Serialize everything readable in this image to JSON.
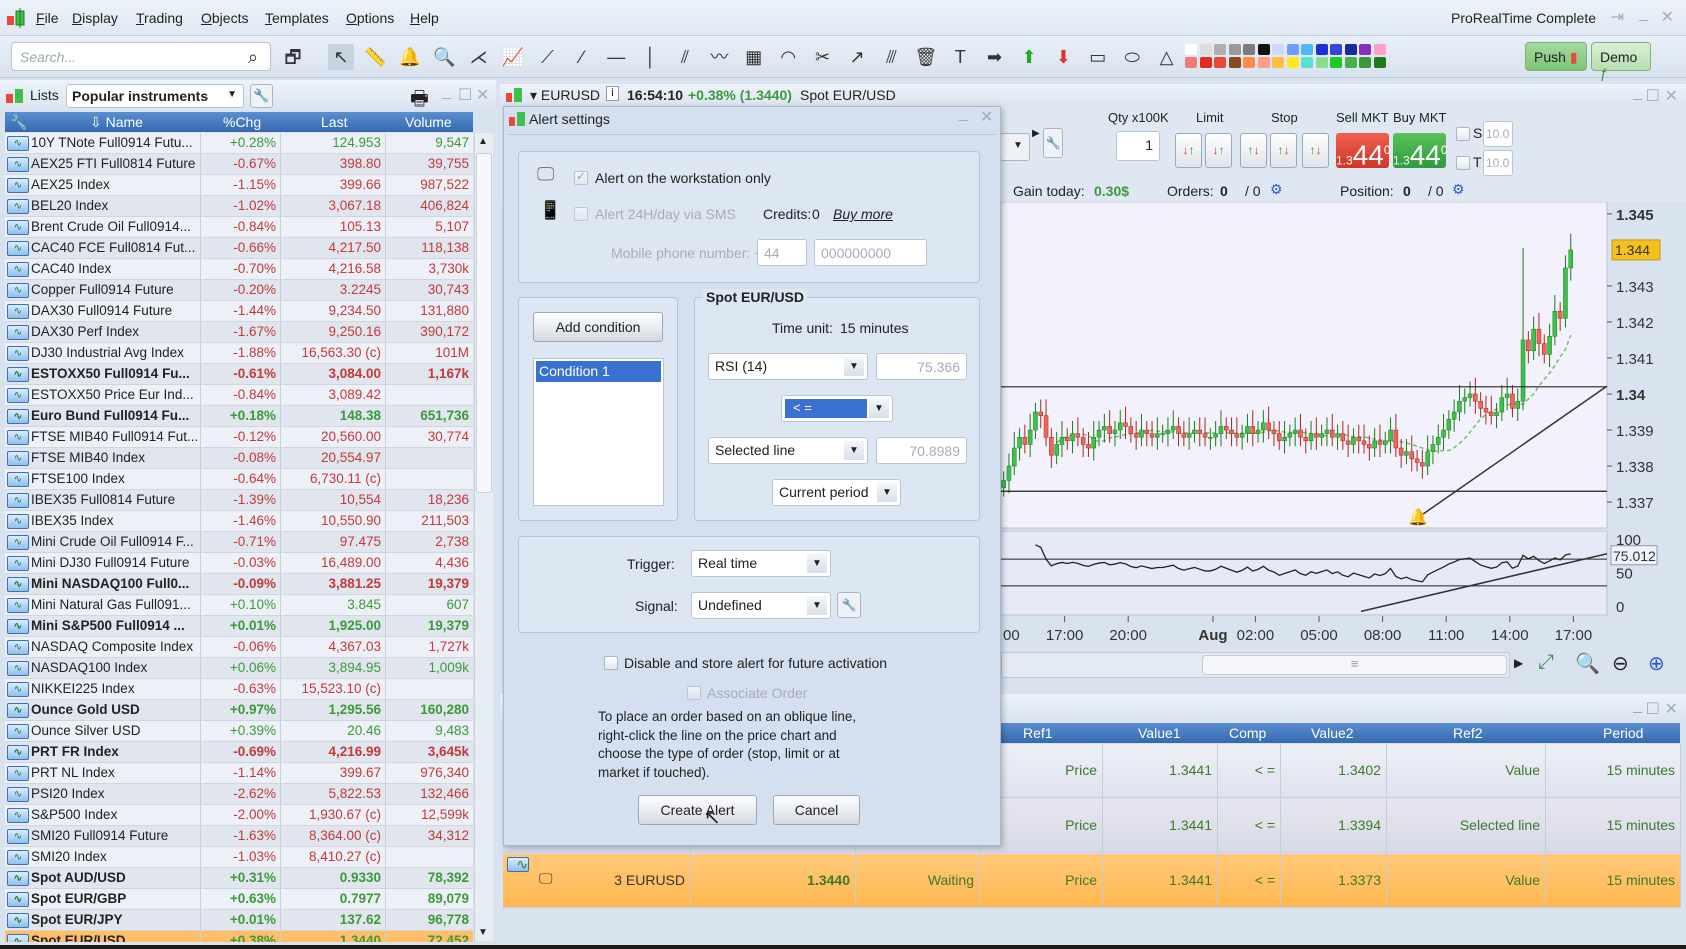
{
  "app": {
    "title": "ProRealTime Complete",
    "push_label": "Push",
    "demo_label": "Demo"
  },
  "menu": [
    "File",
    "Display",
    "Trading",
    "Objects",
    "Templates",
    "Options",
    "Help"
  ],
  "search": {
    "placeholder": "Search..."
  },
  "palette": {
    "top": [
      "#ffffff",
      "#dcdcdc",
      "#b0b0b0",
      "#999999",
      "#7d7d7d",
      "#111111",
      "#cdd7ff",
      "#6f9cff",
      "#4fb9f5",
      "#1c2ed8",
      "#3346d8",
      "#1a2a9a",
      "#8a2ec0",
      "#ff9ec8"
    ],
    "bottom": [
      "#f07a7a",
      "#e8281e",
      "#e84a3a",
      "#8a4a1e",
      "#ff8a4a",
      "#ff9a8a",
      "#ffc040",
      "#ffe81e",
      "#5ae0d0",
      "#8ae08a",
      "#1ec81e",
      "#4ab04a",
      "#3a9a3a",
      "#1e7a1e"
    ]
  },
  "lists": {
    "label": "Lists",
    "selected_list": "Popular instruments",
    "columns": [
      "Name",
      "%Chg",
      "Last",
      "Volume"
    ],
    "rows": [
      [
        "10Y TNote Full0914 Futu...",
        "+0.28%",
        "124.953",
        "9,547",
        "g",
        0
      ],
      [
        "AEX25 FTI Full0814 Future",
        "-0.67%",
        "398.80",
        "39,755",
        "r",
        0
      ],
      [
        "AEX25 Index",
        "-1.15%",
        "399.66",
        "987,522",
        "r",
        0
      ],
      [
        "BEL20 Index",
        "-1.02%",
        "3,067.18",
        "406,824",
        "r",
        0
      ],
      [
        "Brent Crude Oil Full0914...",
        "-0.84%",
        "105.13",
        "5,107",
        "r",
        0
      ],
      [
        "CAC40 FCE Full0814 Fut...",
        "-0.66%",
        "4,217.50",
        "118,138",
        "r",
        0
      ],
      [
        "CAC40 Index",
        "-0.70%",
        "4,216.58",
        "3,730k",
        "r",
        0
      ],
      [
        "Copper Full0914 Future",
        "-0.20%",
        "3.2245",
        "30,743",
        "r",
        0
      ],
      [
        "DAX30 Full0914 Future",
        "-1.44%",
        "9,234.50",
        "131,880",
        "r",
        0
      ],
      [
        "DAX30 Perf Index",
        "-1.67%",
        "9,250.16",
        "390,172",
        "r",
        0
      ],
      [
        "DJ30 Industrial Avg Index",
        "-1.88%",
        "16,563.30 (c)",
        "101M",
        "r",
        0
      ],
      [
        "ESTOXX50 Full0914 Fu...",
        "-0.61%",
        "3,084.00",
        "1,167k",
        "r",
        1
      ],
      [
        "ESTOXX50 Price Eur Ind...",
        "-0.84%",
        "3,089.42",
        "",
        "r",
        0
      ],
      [
        "Euro Bund Full0914 Fu...",
        "+0.18%",
        "148.38",
        "651,736",
        "g",
        1
      ],
      [
        "FTSE MIB40 Full0914 Fut...",
        "-0.12%",
        "20,560.00",
        "30,774",
        "r",
        0
      ],
      [
        "FTSE MIB40 Index",
        "-0.08%",
        "20,554.97",
        "",
        "r",
        0
      ],
      [
        "FTSE100 Index",
        "-0.64%",
        "6,730.11 (c)",
        "",
        "r",
        0
      ],
      [
        "IBEX35 Full0814 Future",
        "-1.39%",
        "10,554",
        "18,236",
        "r",
        0
      ],
      [
        "IBEX35 Index",
        "-1.46%",
        "10,550.90",
        "211,503",
        "r",
        0
      ],
      [
        "Mini Crude Oil Full0914 F...",
        "-0.71%",
        "97.475",
        "2,738",
        "r",
        0
      ],
      [
        "Mini DJ30 Full0914 Future",
        "-0.03%",
        "16,489.00",
        "4,436",
        "r",
        0
      ],
      [
        "Mini NASDAQ100 Full0...",
        "-0.09%",
        "3,881.25",
        "19,379",
        "r",
        1
      ],
      [
        "Mini Natural Gas Full091...",
        "+0.10%",
        "3.845",
        "607",
        "g",
        0
      ],
      [
        "Mini S&P500 Full0914 ...",
        "+0.01%",
        "1,925.00",
        "19,379",
        "g",
        1
      ],
      [
        "NASDAQ Composite Index",
        "-0.06%",
        "4,367.03",
        "1,727k",
        "r",
        0
      ],
      [
        "NASDAQ100 Index",
        "+0.06%",
        "3,894.95",
        "1,009k",
        "g",
        0
      ],
      [
        "NIKKEI225 Index",
        "-0.63%",
        "15,523.10 (c)",
        "",
        "r",
        0
      ],
      [
        "Ounce Gold USD",
        "+0.97%",
        "1,295.56",
        "160,280",
        "g",
        1
      ],
      [
        "Ounce Silver USD",
        "+0.39%",
        "20.46",
        "9,483",
        "g",
        0
      ],
      [
        "PRT FR Index",
        "-0.69%",
        "4,216.99",
        "3,645k",
        "r",
        1
      ],
      [
        "PRT NL Index",
        "-1.14%",
        "399.67",
        "976,340",
        "r",
        0
      ],
      [
        "PSI20 Index",
        "-2.62%",
        "5,822.53",
        "132,466",
        "r",
        0
      ],
      [
        "S&P500 Index",
        "-2.00%",
        "1,930.67 (c)",
        "12,599k",
        "r",
        0
      ],
      [
        "SMI20 Full0914 Future",
        "-1.63%",
        "8,364.00 (c)",
        "34,312",
        "r",
        0
      ],
      [
        "SMI20 Index",
        "-1.03%",
        "8,410.27 (c)",
        "",
        "r",
        0
      ],
      [
        "Spot AUD/USD",
        "+0.31%",
        "0.9330",
        "78,392",
        "g",
        1
      ],
      [
        "Spot EUR/GBP",
        "+0.63%",
        "0.7977",
        "89,079",
        "g",
        1
      ],
      [
        "Spot EUR/JPY",
        "+0.01%",
        "137.62",
        "96,778",
        "g",
        1
      ],
      [
        "Spot EUR/USD",
        "+0.38%",
        "1.3440",
        "72,452",
        "g",
        1
      ]
    ],
    "highlighted_row": 38
  },
  "chart_window": {
    "symbol": "EURUSD",
    "time": "16:54:10",
    "change": "+0.38% (1.3440)",
    "name": "Spot EUR/USD",
    "qty_label": "Qty x100K",
    "qty_value": "1",
    "limit_label": "Limit",
    "stop_label": "Stop",
    "sell_label": "Sell MKT",
    "buy_label": "Buy MKT",
    "sell_price": {
      "pre": "1.3",
      "big": "44",
      "sup": "0"
    },
    "buy_price": {
      "pre": "1.3",
      "big": "44",
      "sup": "0"
    },
    "s_label": "S",
    "t_label": "T",
    "s_value": "10.0",
    "t_value": "10.0",
    "gain_label": "Gain today:",
    "gain_value": "0.30$",
    "orders_label": "Orders:",
    "orders_a": "0",
    "orders_b": "/ 0",
    "position_label": "Position:",
    "position_a": "0",
    "position_b": "/ 0",
    "current_price_label": "1.3440",
    "rsi_value_label": "75.012"
  },
  "chart_data": {
    "type": "candlestick",
    "timeframe": "15 minutes",
    "start": "14:00",
    "closes": [
      1.3376,
      1.338,
      1.3385,
      1.3388,
      1.3386,
      1.339,
      1.3395,
      1.3394,
      1.3388,
      1.3383,
      1.3386,
      1.3388,
      1.3387,
      1.3389,
      1.3388,
      1.3386,
      1.3385,
      1.3388,
      1.339,
      1.3391,
      1.3389,
      1.339,
      1.3392,
      1.3391,
      1.3389,
      1.3388,
      1.339,
      1.3389,
      1.3388,
      1.3389,
      1.3389,
      1.339,
      1.3391,
      1.3389,
      1.3388,
      1.3389,
      1.339,
      1.3389,
      1.3388,
      1.3388,
      1.3389,
      1.3391,
      1.339,
      1.3389,
      1.3388,
      1.3389,
      1.3391,
      1.3389,
      1.339,
      1.3392,
      1.339,
      1.3389,
      1.3387,
      1.3388,
      1.3389,
      1.339,
      1.3388,
      1.3387,
      1.3389,
      1.3388,
      1.3389,
      1.339,
      1.3388,
      1.3389,
      1.3387,
      1.3386,
      1.3388,
      1.3387,
      1.3386,
      1.3385,
      1.3387,
      1.3386,
      1.3387,
      1.339,
      1.3385,
      1.3383,
      1.3384,
      1.3382,
      1.3381,
      1.338,
      1.3384,
      1.3386,
      1.3388,
      1.339,
      1.3393,
      1.3395,
      1.3398,
      1.3399,
      1.34,
      1.3398,
      1.3396,
      1.3395,
      1.3394,
      1.3395,
      1.3399,
      1.34,
      1.3396,
      1.3398,
      1.3415,
      1.3412,
      1.3418,
      1.3414,
      1.3411,
      1.3416,
      1.3423,
      1.3421,
      1.3435,
      1.344
    ],
    "price_ticks": [
      "1.345",
      "1.343",
      "1.342",
      "1.341",
      "1.34",
      "1.339",
      "1.338",
      "1.337"
    ],
    "price_range": [
      1.33628,
      1.34533
    ],
    "horizontal_lines": [
      1.3402,
      1.3373
    ],
    "rsi_ticks": [
      "100",
      "50",
      "0"
    ],
    "rsi_lines": [
      70,
      30
    ],
    "time_ticks": [
      "00",
      "17:00",
      "20:00",
      "Aug",
      "02:00",
      "05:00",
      "08:00",
      "11:00",
      "14:00",
      "17:00"
    ],
    "colors": {
      "up": "#3cc24a",
      "down": "#f0645a"
    }
  },
  "alert_dialog": {
    "title": "Alert settings",
    "workstation_label": "Alert on the workstation only",
    "workstation_checked": true,
    "sms_label": "Alert 24H/day via SMS",
    "sms_checked": false,
    "credits_label": "Credits:",
    "credits_value": "0",
    "buy_more": "Buy more",
    "phone_label": "Mobile phone number: +",
    "phone_code": "44",
    "phone_number": "000000000",
    "add_condition": "Add condition",
    "conditions": [
      "Condition 1"
    ],
    "instrument": "Spot EUR/USD",
    "time_unit_label": "Time unit:",
    "time_unit_value": "15 minutes",
    "indicator": "RSI (14)",
    "indicator_value": "75.366",
    "comparator": "< =",
    "reference": "Selected line",
    "reference_value": "70.8989",
    "period": "Current period",
    "trigger_label": "Trigger:",
    "trigger": "Real time",
    "signal_label": "Signal:",
    "signal": "Undefined",
    "disable_label": "Disable and store alert for future activation",
    "associate_label": "Associate Order",
    "help_lines": [
      "To place an order based on an oblique line,",
      "right-click the line on the price chart and",
      "choose the type of order (stop, limit or at",
      "market if touched)."
    ],
    "create": "Create Alert",
    "cancel": "Cancel"
  },
  "alerts_table": {
    "columns": [
      "Ref1",
      "Value1",
      "Comp",
      "Value2",
      "Ref2",
      "Period"
    ],
    "rows": [
      {
        "name": "",
        "price": "",
        "status": "",
        "ref1": "Price",
        "value1": "1.3441",
        "comp": "< =",
        "value2": "1.3402",
        "ref2": "Value",
        "period": "15 minutes"
      },
      {
        "name": "",
        "price": "",
        "status": "",
        "ref1": "Price",
        "value1": "1.3441",
        "comp": "< =",
        "value2": "1.3394",
        "ref2": "Selected line",
        "period": "15 minutes"
      },
      {
        "name": "3 EURUSD",
        "price": "1.3440",
        "status": "Waiting",
        "ref1": "Price",
        "value1": "1.3441",
        "comp": "< =",
        "value2": "1.3373",
        "ref2": "Value",
        "period": "15 minutes"
      }
    ]
  }
}
